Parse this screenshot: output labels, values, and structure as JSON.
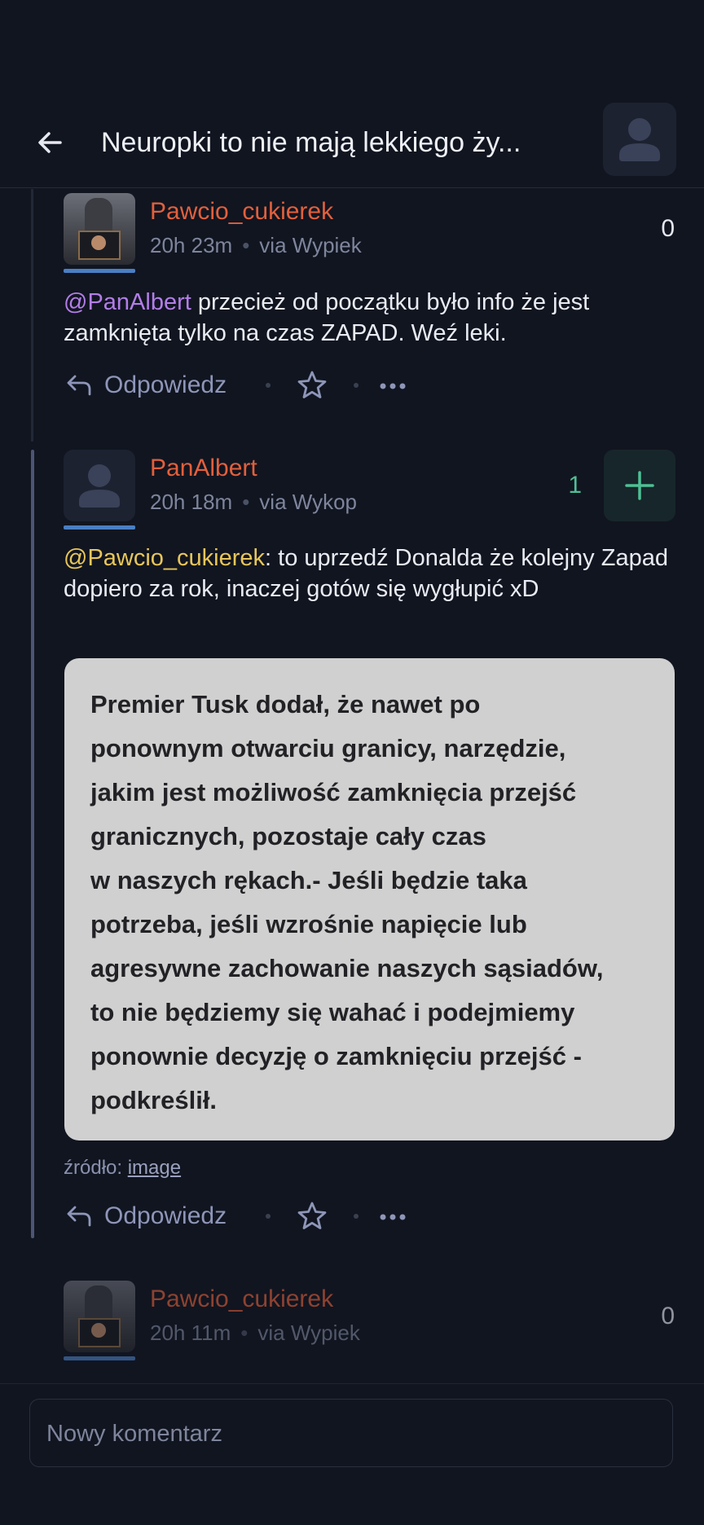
{
  "header": {
    "title": "Neuropki to nie mają lekkiego ży...",
    "back_icon": "arrow-left-icon",
    "avatar_icon": "user-icon"
  },
  "comments": [
    {
      "username": "Pawcio_cukierek",
      "time": "20h 23m",
      "via": "via Wypiek",
      "score": "0",
      "mention": "@PanAlbert",
      "text": " przecież od początku było info że jest zamknięta tylko na czas ZAPAD. Weź leki.",
      "reply_label": "Odpowiedz"
    },
    {
      "username": "PanAlbert",
      "time": "20h 18m",
      "via": "via Wykop",
      "score": "1",
      "mention": "@Pawcio_cukierek",
      "text": ": to uprzedź Donalda że kolejny Zapad dopiero za rok, inaczej gotów się wygłupić xD",
      "image_text": "Premier Tusk dodał, że nawet po\nponownym otwarciu granicy, narzędzie,\njakim jest możliwość zamknięcia przejść\ngranicznych, pozostaje cały czas\nw naszych rękach.- Jeśli będzie taka\npotrzeba, jeśli wzrośnie napięcie lub\nagresywne zachowanie naszych sąsiadów,\nto nie będziemy się wahać i podejmiemy\nponownie decyzję o zamknięciu przejść -\n podkreślił.",
      "source_label": "źródło:",
      "source_link": "image",
      "reply_label": "Odpowiedz"
    },
    {
      "username": "Pawcio_cukierek",
      "time": "20h 11m",
      "via": "via Wypiek",
      "score": "0"
    }
  ],
  "composer": {
    "placeholder": "Nowy komentarz"
  },
  "colors": {
    "background": "#111520",
    "username": "#e2603c",
    "mention_purple": "#b37ee8",
    "mention_yellow": "#e8c65a",
    "score_positive": "#4fbf95",
    "action": "#8e96b8"
  }
}
